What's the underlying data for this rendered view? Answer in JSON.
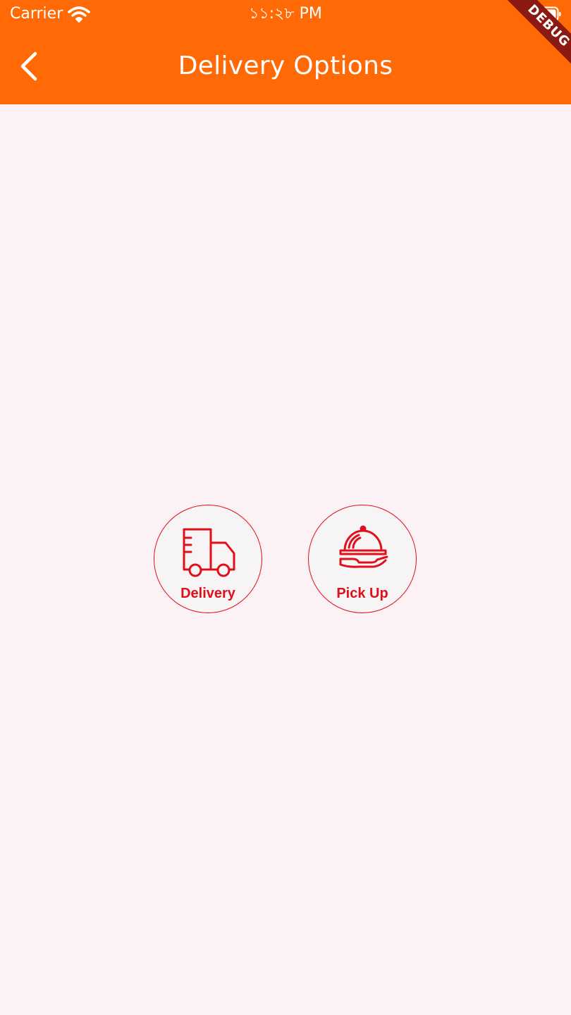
{
  "status_bar": {
    "carrier": "Carrier",
    "time": "১১:২৮ PM",
    "wifi_icon": "wifi-icon",
    "battery_icon": "battery-icon"
  },
  "header": {
    "back_icon": "chevron-left-icon",
    "title": "Delivery Options",
    "background": "#ff6a06",
    "debug_banner": "DEBUG"
  },
  "options": [
    {
      "label": "Delivery",
      "icon": "delivery-truck-icon"
    },
    {
      "label": "Pick Up",
      "icon": "food-cloche-icon"
    }
  ],
  "colors": {
    "accent": "#e0101a",
    "page_background": "#fcf2f6",
    "debug_ribbon": "#8b1a12"
  }
}
